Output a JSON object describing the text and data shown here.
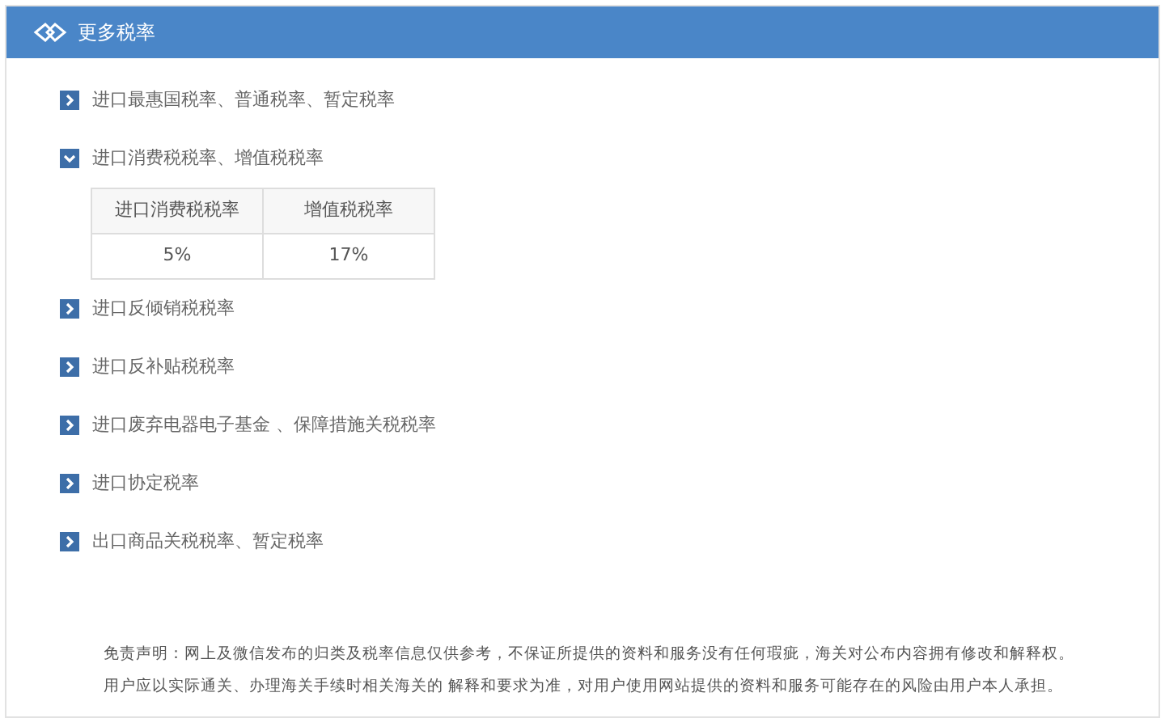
{
  "header": {
    "title": "更多税率"
  },
  "items": [
    {
      "label": "进口最惠国税率、普通税率、暂定税率",
      "expanded": false
    },
    {
      "label": "进口消费税税率、增值税税率",
      "expanded": true,
      "table": {
        "columns": [
          "进口消费税税率",
          "增值税税率"
        ],
        "rows": [
          [
            "5%",
            "17%"
          ]
        ]
      }
    },
    {
      "label": "进口反倾销税税率",
      "expanded": false
    },
    {
      "label": "进口反补贴税税率",
      "expanded": false
    },
    {
      "label": "进口废弃电器电子基金 、保障措施关税税率",
      "expanded": false
    },
    {
      "label": "进口协定税率",
      "expanded": false
    },
    {
      "label": "出口商品关税税率、暂定税率",
      "expanded": false
    }
  ],
  "disclaimer": [
    "免责声明：网上及微信发布的归类及税率信息仅供参考，不保证所提供的资料和服务没有任何瑕疵，海关对公布内容拥有修改和解释权。",
    "用户应以实际通关、办理海关手续时相关海关的 解释和要求为准，对用户使用网站提供的资料和服务可能存在的风险由用户本人承担。"
  ]
}
